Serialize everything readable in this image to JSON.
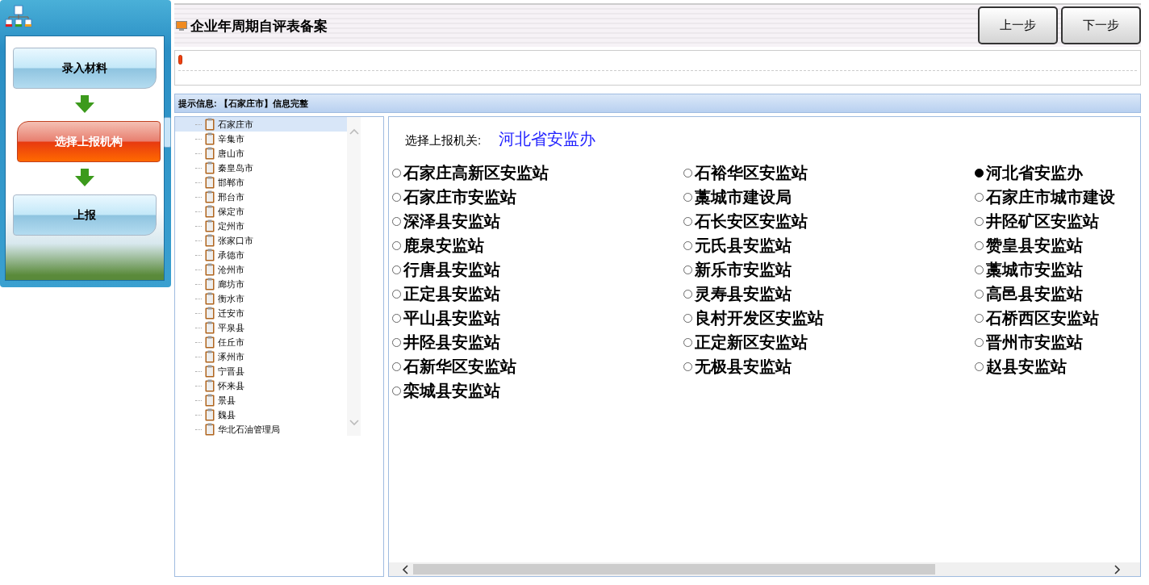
{
  "steps": [
    {
      "label": "录入材料",
      "selected": false
    },
    {
      "label": "选择上报机构",
      "selected": true
    },
    {
      "label": "上报",
      "selected": false
    }
  ],
  "header": {
    "title": "企业年周期自评表备案",
    "buttons": [
      "上一步",
      "下一步"
    ]
  },
  "progress": {
    "level": 0.0
  },
  "info": "提示信息: 【石家庄市】信息完整",
  "tree": {
    "items": [
      {
        "label": "石家庄市",
        "selected": true
      },
      {
        "label": "辛集市",
        "selected": false
      },
      {
        "label": "唐山市",
        "selected": false
      },
      {
        "label": "秦皇岛市",
        "selected": false
      },
      {
        "label": "邯郸市",
        "selected": false
      },
      {
        "label": "邢台市",
        "selected": false
      },
      {
        "label": "保定市",
        "selected": false
      },
      {
        "label": "定州市",
        "selected": false
      },
      {
        "label": "张家口市",
        "selected": false
      },
      {
        "label": "承德市",
        "selected": false
      },
      {
        "label": "沧州市",
        "selected": false
      },
      {
        "label": "廊坊市",
        "selected": false
      },
      {
        "label": "衡水市",
        "selected": false
      },
      {
        "label": "迁安市",
        "selected": false
      },
      {
        "label": "平泉县",
        "selected": false
      },
      {
        "label": "任丘市",
        "selected": false
      },
      {
        "label": "涿州市",
        "selected": false
      },
      {
        "label": "宁晋县",
        "selected": false
      },
      {
        "label": "怀来县",
        "selected": false
      },
      {
        "label": "景县",
        "selected": false
      },
      {
        "label": "魏县",
        "selected": false
      },
      {
        "label": "华北石油管理局",
        "selected": false
      }
    ]
  },
  "agency": {
    "label": "选择上报机关:",
    "value": "河北省安监办",
    "options": [
      {
        "label": "石家庄高新区安监站",
        "selected": false
      },
      {
        "label": "石裕华区安监站",
        "selected": false
      },
      {
        "label": "河北省安监办",
        "selected": true
      },
      {
        "label": "石家庄市安监站",
        "selected": false
      },
      {
        "label": "藁城市建设局",
        "selected": false
      },
      {
        "label": "石家庄市城市建设",
        "selected": false
      },
      {
        "label": "深泽县安监站",
        "selected": false
      },
      {
        "label": "石长安区安监站",
        "selected": false
      },
      {
        "label": "井陉矿区安监站",
        "selected": false
      },
      {
        "label": "鹿泉安监站",
        "selected": false
      },
      {
        "label": "元氏县安监站",
        "selected": false
      },
      {
        "label": "赞皇县安监站",
        "selected": false
      },
      {
        "label": "行唐县安监站",
        "selected": false
      },
      {
        "label": "新乐市安监站",
        "selected": false
      },
      {
        "label": "藁城市安监站",
        "selected": false
      },
      {
        "label": "正定县安监站",
        "selected": false
      },
      {
        "label": "灵寿县安监站",
        "selected": false
      },
      {
        "label": "高邑县安监站",
        "selected": false
      },
      {
        "label": "平山县安监站",
        "selected": false
      },
      {
        "label": "良村开发区安监站",
        "selected": false
      },
      {
        "label": "石桥西区安监站",
        "selected": false
      },
      {
        "label": "井陉县安监站",
        "selected": false
      },
      {
        "label": "正定新区安监站",
        "selected": false
      },
      {
        "label": "晋州市安监站",
        "selected": false
      },
      {
        "label": "石新华区安监站",
        "selected": false
      },
      {
        "label": "无极县安监站",
        "selected": false
      },
      {
        "label": "赵县安监站",
        "selected": false
      },
      {
        "label": "栾城县安监站",
        "selected": false
      }
    ]
  }
}
